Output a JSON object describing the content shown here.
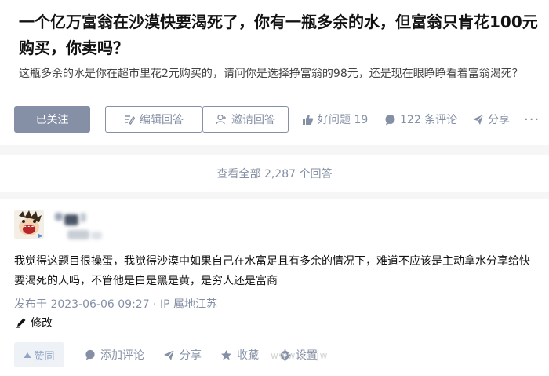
{
  "question": {
    "title": "一个亿万富翁在沙漠快要渴死了，你有一瓶多余的水，但富翁只肯花100元购买，你卖吗？",
    "detail": "这瓶多余的水是你在超市里花2元购买的，请问你是选择挣富翁的98元，还是现在眼睁睁看着富翁渴死？",
    "actions": {
      "followed_label": "已关注",
      "edit_label": "编辑回答",
      "invite_label": "邀请回答",
      "good_question_label": "好问题 19",
      "comments_label": "122 条评论",
      "share_label": "分享",
      "more_label": "···"
    }
  },
  "view_all": {
    "label": "查看全部 2,287 个回答"
  },
  "answer": {
    "text": "我觉得这题目很操蛋，我觉得沙漠中如果自己在水富足且有多余的情况下，难道不应该是主动拿水分享给快要渴死的人吗，不管他是白是黑是黄，是穷人还是富商",
    "published": "发布于 2023-06-06 09:27 · IP 属地江苏",
    "edit_label": "修改",
    "actions": {
      "vote_label": "赞同",
      "comment_label": "添加评论",
      "share_label": "分享",
      "collect_label": "收藏",
      "settings_label": "设置"
    }
  },
  "watermark": {
    "text": "www.dafjw"
  },
  "colors": {
    "primary_gray": "#8590a6",
    "vote_bg": "#eef2f7",
    "page_bg": "#f6f6f6"
  }
}
